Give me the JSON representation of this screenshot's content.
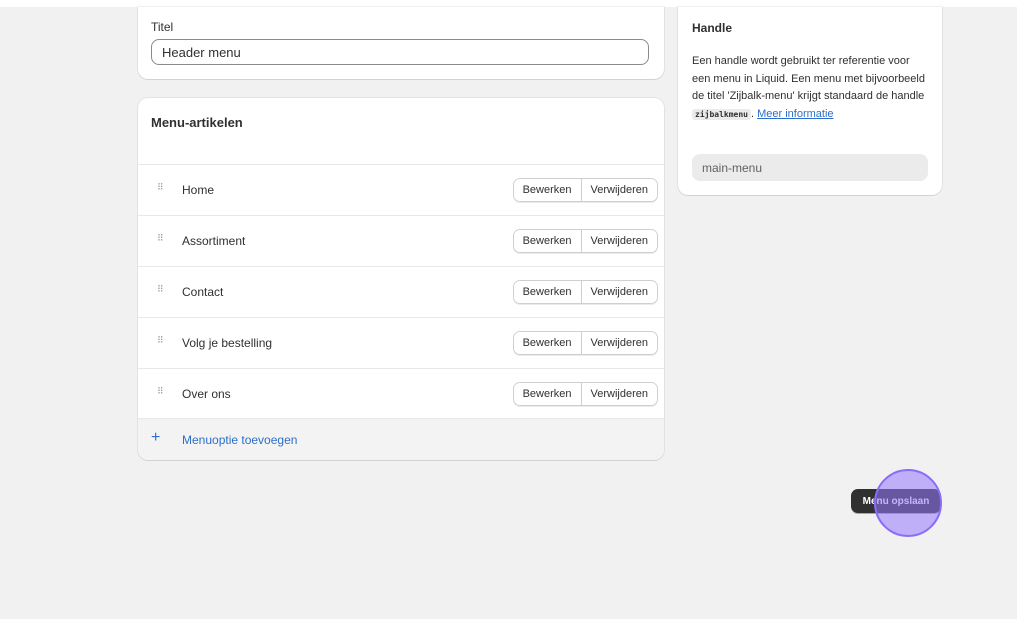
{
  "title_section": {
    "label": "Titel",
    "value": "Header menu"
  },
  "menu_section": {
    "heading": "Menu-artikelen",
    "drag_icon": "drag-handle-icon",
    "items": [
      {
        "label": "Home",
        "edit": "Bewerken",
        "delete": "Verwijderen"
      },
      {
        "label": "Assortiment",
        "edit": "Bewerken",
        "delete": "Verwijderen"
      },
      {
        "label": "Contact",
        "edit": "Bewerken",
        "delete": "Verwijderen"
      },
      {
        "label": "Volg je bestelling",
        "edit": "Bewerken",
        "delete": "Verwijderen"
      },
      {
        "label": "Over ons",
        "edit": "Bewerken",
        "delete": "Verwijderen"
      }
    ],
    "add_label": "Menuoptie toevoegen"
  },
  "handle_section": {
    "title": "Handle",
    "desc_part1": "Een handle wordt gebruikt ter referentie voor een menu in Liquid. Een menu met bijvoorbeeld de titel 'Zijbalk-menu' krijgt standaard de handle",
    "code": "zijbalkmenu",
    "desc_part2": ".",
    "link": "Meer informatie",
    "value": "main-menu"
  },
  "save_button": "Menu opslaan",
  "colors": {
    "accent": "#2c6ecb",
    "primary_button": "#303030",
    "click_highlight": "#8b6cf6"
  }
}
